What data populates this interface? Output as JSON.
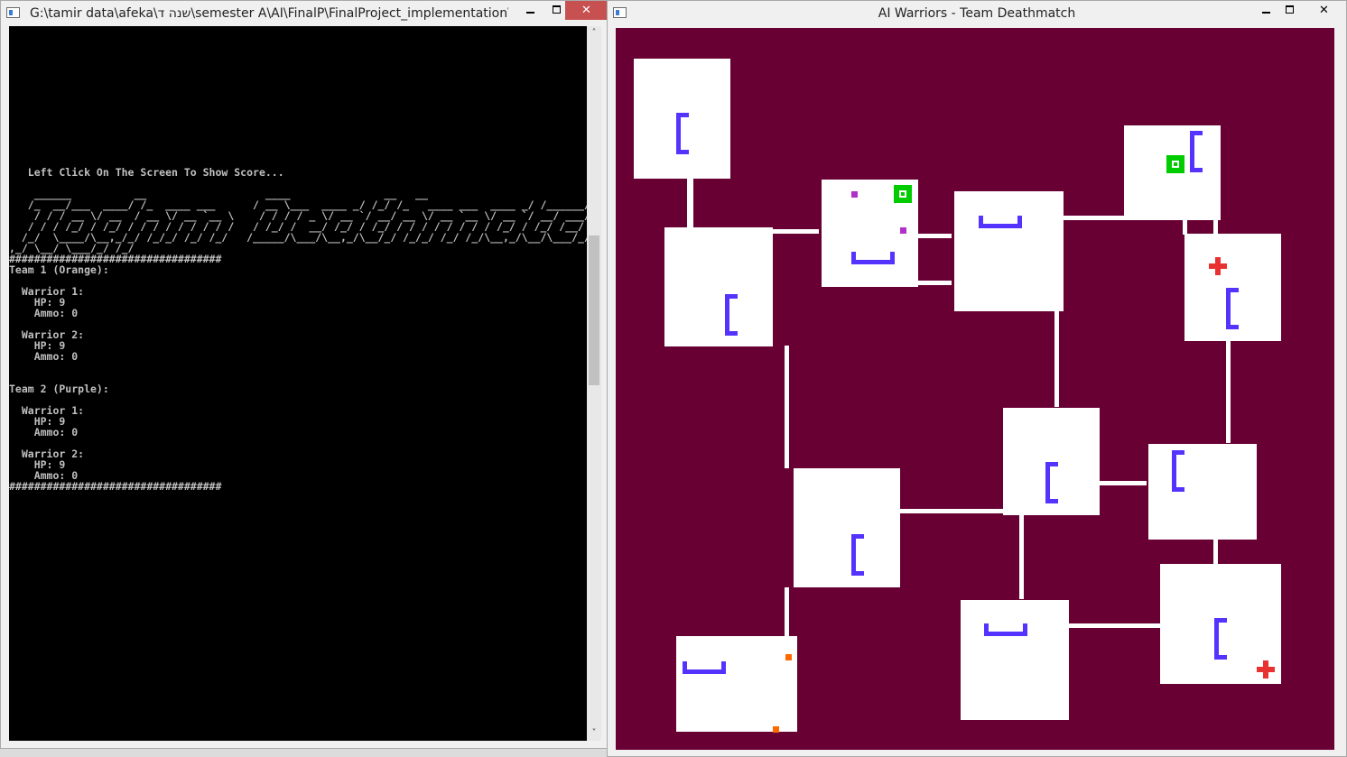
{
  "console_window": {
    "title": "G:\\tamir data\\afeka\\שנה ד\\semester A\\AI\\FinalP\\FinalProject_implementation\\...",
    "controls": {
      "minimize": "–",
      "maximize": "□",
      "close": "✕"
    },
    "lines": [
      "",
      "",
      "",
      "",
      "",
      "",
      "",
      "",
      "",
      "",
      "",
      "",
      "",
      "   Left Click On The Screen To Show Score...",
      "",
      "    ______          __                   ____               __   __",
      "   /_  __/___  ____/ /_  ____ ___      / __ \\___  ____ _/ /_/ /_   ____ ___  ____ _/ /______/ /_",
      "    / / / __ \\/ __  / __ \\/ __ `__ \\    / / / / _ \\/ __ `/ __/ __ \\/ __ `__ \\/ __ `/ __/ ___/ __ \\",
      "   / / / /_/ / /_/ / / / / / / / / /   / /_/ /  __/ /_/ / /_/ / / / / / / / / /_/ / /_/ /__/ / / /",
      "  /_/  \\____/\\__,_/_/ /_/_/ /_/ /_/   /_____/\\___/\\__,_/\\__/_/ /_/_/ /_/ /_/\\__,_/\\__/\\___/_/ /_/",
      ",_/ \\__/ \\___/_/ /_/",
      "##################################",
      "Team 1 (Orange):",
      "",
      "  Warrior 1:",
      "    HP: 9",
      "    Ammo: 0",
      "",
      "  Warrior 2:",
      "    HP: 9",
      "    Ammo: 0",
      "",
      "",
      "Team 2 (Purple):",
      "",
      "  Warrior 1:",
      "    HP: 9",
      "    Ammo: 0",
      "",
      "  Warrior 2:",
      "    HP: 9",
      "    Ammo: 0",
      "##################################"
    ],
    "scroll_up": "˄",
    "scroll_down": "˅"
  },
  "game_window": {
    "title": "AI Warriors - Team Deathmatch",
    "controls": {
      "minimize": "–",
      "maximize": "□",
      "close": "✕"
    }
  },
  "colors": {
    "map_background": "#680034",
    "room": "#ffffff",
    "ammo": "#5533ff",
    "health": "#e83232",
    "team1": "#ff6a00",
    "team2": "#b030c8",
    "green_marker": "#00cc00"
  },
  "icons": {
    "ammo": "ammo-bracket-icon",
    "health": "health-cross-icon"
  }
}
